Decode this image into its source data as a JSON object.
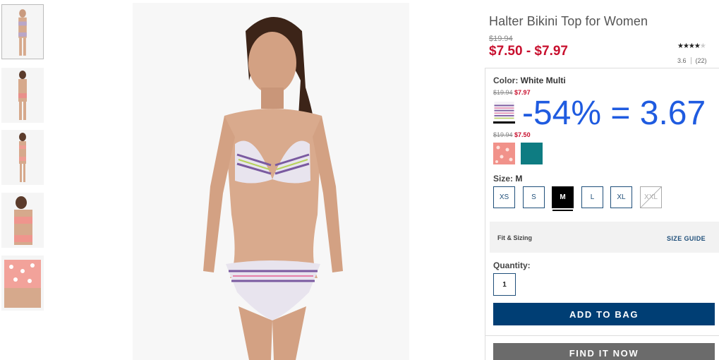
{
  "product": {
    "title": "Halter Bikini Top for Women",
    "was_price": "$19.94",
    "price_range": "$7.50 - $7.97",
    "rating": 3.6,
    "rating_text": "3.6",
    "review_count": "(22)",
    "stars_full": "★★★★",
    "stars_empty": "★"
  },
  "color": {
    "label": "Color:",
    "selected": "White Multi",
    "price_groups": [
      {
        "was": "$19.94",
        "now": "$7.97"
      },
      {
        "was": "$19.94",
        "now": "$7.50"
      }
    ],
    "swatches": [
      {
        "name": "white-multi",
        "hex": "#e9e4ee",
        "selected": true
      },
      {
        "name": "coral-print",
        "hex": "#f1928a"
      },
      {
        "name": "teal",
        "hex": "#0e7c82"
      }
    ]
  },
  "annotation": "-54% = 3.67",
  "size": {
    "label": "Size:",
    "selected": "M",
    "options": [
      {
        "label": "XS"
      },
      {
        "label": "S"
      },
      {
        "label": "M"
      },
      {
        "label": "L"
      },
      {
        "label": "XL"
      },
      {
        "label": "XXL"
      }
    ]
  },
  "fit": {
    "label": "Fit & Sizing",
    "guide": "SIZE GUIDE"
  },
  "quantity": {
    "label": "Quantity:",
    "value": "1"
  },
  "actions": {
    "add_to_bag": "ADD TO BAG",
    "find_it_now": "FIND IT NOW"
  },
  "colors": {
    "sale_red": "#c8102e",
    "primary_blue": "#003e74",
    "link_blue": "#1f4f7a",
    "annotation_blue": "#1f5be0"
  }
}
